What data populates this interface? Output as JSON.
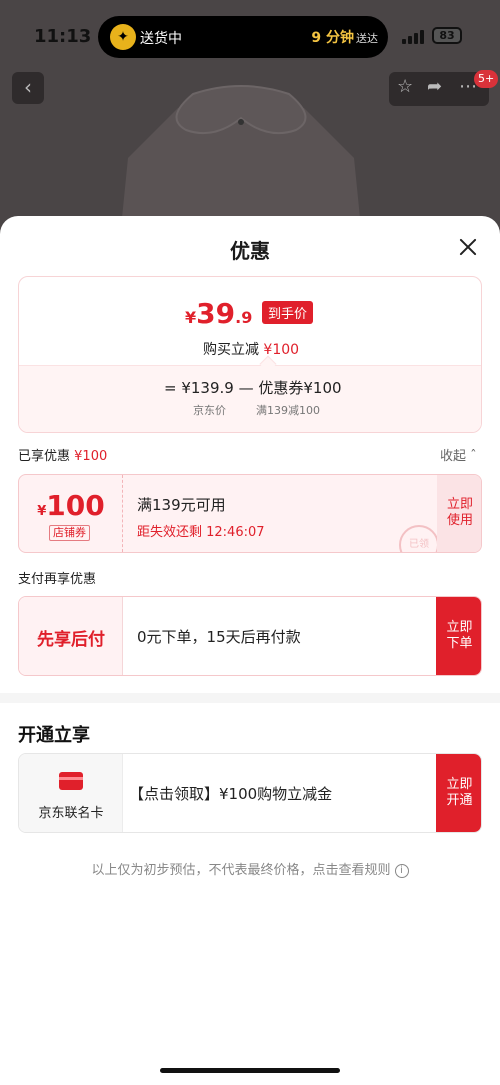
{
  "status_bar": {
    "time": "11:13",
    "island_text": "送货中",
    "island_eta": "9 分钟",
    "island_eta_suffix": "送达",
    "battery": "83"
  },
  "product_nav": {
    "back_icon": "chevron-left-icon",
    "actions": [
      "star-icon",
      "share-icon",
      "more-icon"
    ],
    "badge": "5+"
  },
  "sheet": {
    "title": "优惠",
    "close_icon": "close-icon",
    "price_card": {
      "currency": "¥",
      "price_int": "39",
      "price_dec": ".9",
      "price_tag": "到手价",
      "discount_label": "购买立减",
      "discount_value": "¥100",
      "calc": "=  ¥139.9  —  优惠券¥100",
      "calc_sub_price": "京东价",
      "calc_sub_coupon": "满139减100"
    },
    "enjoyed": {
      "label": "已享优惠",
      "value": "¥100",
      "collapse": "收起",
      "collapse_icon": "chevron-up-icon"
    },
    "coupon": {
      "currency": "¥",
      "amount": "100",
      "type": "店铺券",
      "title": "满139元可用",
      "expire": "距失效还剩 12:46:07",
      "button": "立即使用",
      "stamp": "已领"
    },
    "pay_section_label": "支付再享优惠",
    "pay_later": {
      "name": "先享后付",
      "desc": "0元下单，15天后再付款",
      "button": "立即下单"
    },
    "open_section_title": "开通立享",
    "union_card": {
      "icon": "credit-card-icon",
      "name": "京东联名卡",
      "desc": "【点击领取】¥100购物立减金",
      "button": "立即开通"
    },
    "footnote": "以上仅为初步预估，不代表最终价格，点击查看规则",
    "info_icon": "ⓘ"
  },
  "colors": {
    "accent_red": "#e0202b",
    "light_red_bg": "#fff2f3"
  }
}
